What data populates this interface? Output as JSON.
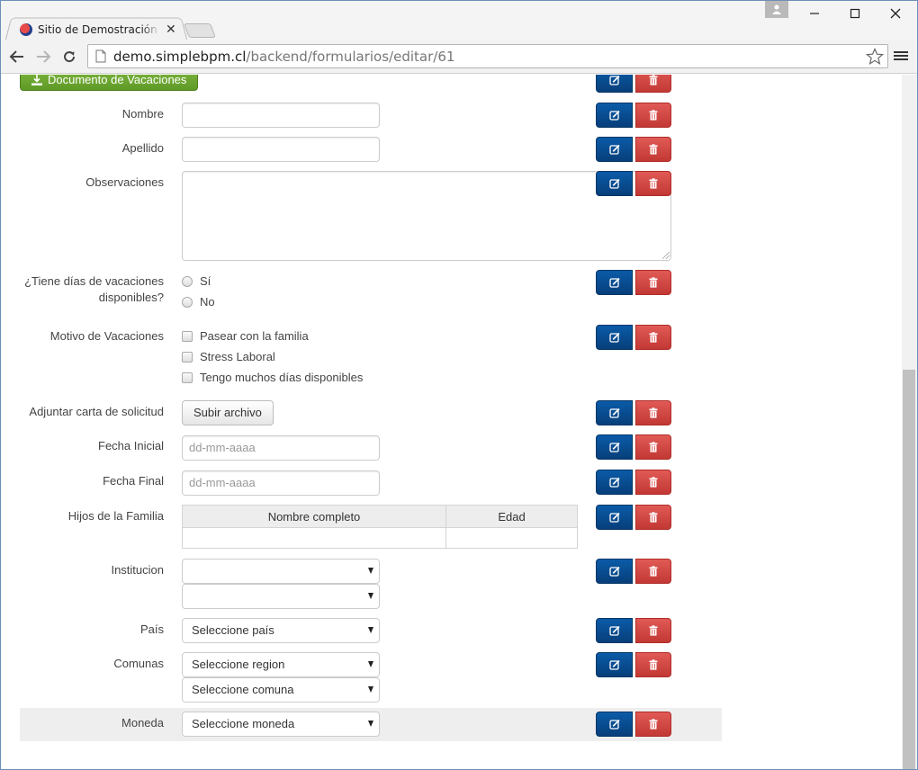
{
  "browser": {
    "tab_title": "Sitio de Demostración - Formularios",
    "url_host": "demo.simplebpm.cl",
    "url_path": "/backend/formularios/editar/61"
  },
  "colors": {
    "edit_button": "#0a4d8f",
    "delete_button": "#d9534f",
    "download_button": "#6aa52f"
  },
  "form": {
    "top_button_label": "Documento de Vacaciones",
    "fields": {
      "nombre": {
        "label": "Nombre",
        "value": ""
      },
      "apellido": {
        "label": "Apellido",
        "value": ""
      },
      "observaciones": {
        "label": "Observaciones",
        "value": ""
      },
      "vacaciones": {
        "label_line1": "¿Tiene días de vacaciones",
        "label_line2": "disponibles?",
        "options": [
          "Sí",
          "No"
        ]
      },
      "motivo": {
        "label": "Motivo de Vacaciones",
        "options": [
          "Pasear con la familia",
          "Stress Laboral",
          "Tengo muchos días disponibles"
        ]
      },
      "adjuntar": {
        "label": "Adjuntar carta de solicitud",
        "button": "Subir archivo"
      },
      "fecha_inicial": {
        "label": "Fecha Inicial",
        "placeholder": "dd-mm-aaaa"
      },
      "fecha_final": {
        "label": "Fecha Final",
        "placeholder": "dd-mm-aaaa"
      },
      "hijos": {
        "label": "Hijos de la Familia",
        "columns": [
          "Nombre completo",
          "Edad"
        ]
      },
      "institucion": {
        "label": "Institucion",
        "select1": "",
        "select2": ""
      },
      "pais": {
        "label": "País",
        "selected": "Seleccione país"
      },
      "comunas": {
        "label": "Comunas",
        "region": "Seleccione region",
        "comuna": "Seleccione comuna"
      },
      "moneda": {
        "label": "Moneda",
        "selected": "Seleccione moneda"
      }
    }
  }
}
